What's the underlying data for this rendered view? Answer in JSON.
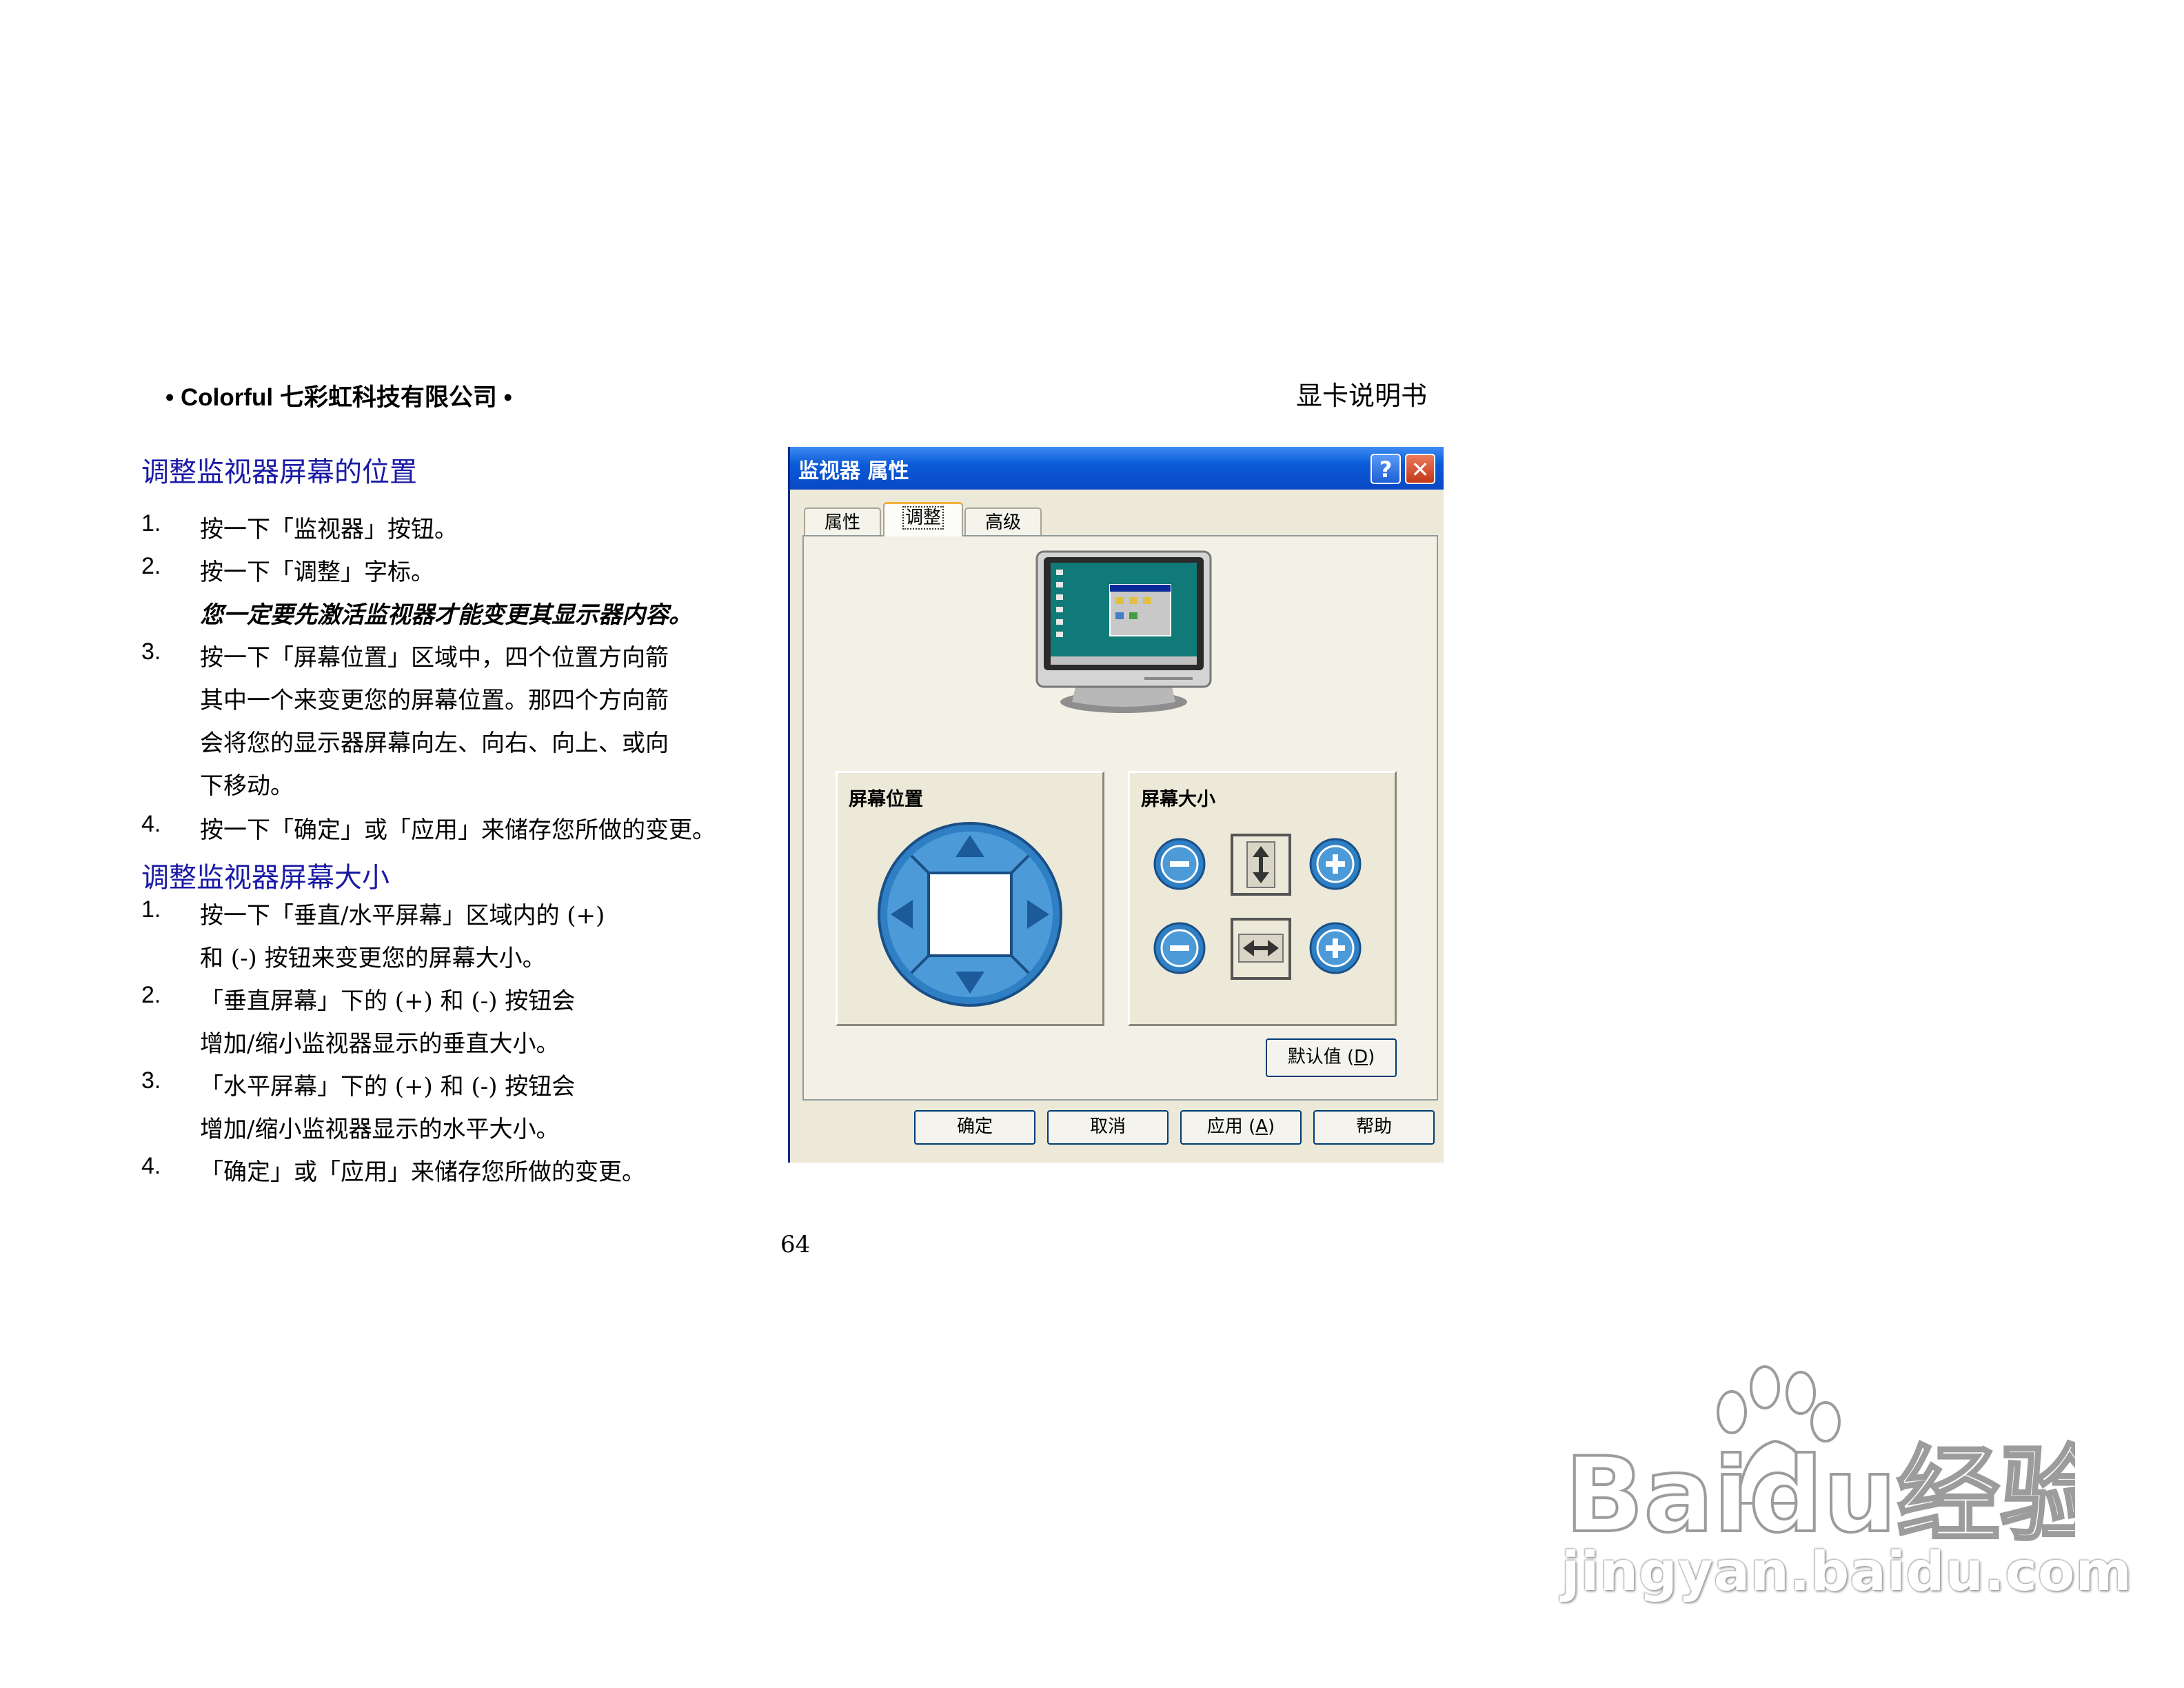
{
  "header": {
    "left": "• Colorful  七彩虹科技有限公司 •",
    "right": "显卡说明书"
  },
  "section1": {
    "heading": "调整监视器屏幕的位置",
    "items": [
      {
        "num": "1.",
        "lines": [
          "按一下「监视器」按钮。"
        ]
      },
      {
        "num": "2.",
        "lines": [
          "按一下「调整」字标。"
        ],
        "note": "您一定要先激活监视器才能变更其显示器内容。"
      },
      {
        "num": "3.",
        "lines": [
          "按一下「屏幕位置」区域中，四个位置方向箭",
          "其中一个来变更您的屏幕位置。那四个方向箭",
          "会将您的显示器屏幕向左、向右、向上、或向",
          "下移动。"
        ]
      },
      {
        "num": "4.",
        "lines": [
          "按一下「确定」或「应用」来储存您所做的变更。"
        ]
      }
    ]
  },
  "section2": {
    "heading": "调整监视器屏幕大小",
    "items": [
      {
        "num": "1.",
        "lines": [
          "按一下「垂直/水平屏幕」区域内的  (+)",
          "和  (-)  按钮来变更您的屏幕大小。"
        ]
      },
      {
        "num": "2.",
        "lines": [
          "「垂直屏幕」下的  (+)  和  (-)  按钮会",
          "增加/缩小监视器显示的垂直大小。"
        ]
      },
      {
        "num": "3.",
        "lines": [
          "「水平屏幕」下的  (+)  和  (-)  按钮会",
          "增加/缩小监视器显示的水平大小。"
        ]
      },
      {
        "num": "4.",
        "lines": [
          "「确定」或「应用」来储存您所做的变更。"
        ]
      }
    ]
  },
  "dialog": {
    "title": "监视器  属性",
    "help_glyph": "?",
    "close_glyph": "✕",
    "tabs": [
      "属性",
      "调整",
      "高级"
    ],
    "active_tab": "调整",
    "position_group": "屏幕位置",
    "size_group": "屏幕大小",
    "defaults_button": "默认值",
    "defaults_key": "D",
    "buttons": {
      "ok": "确定",
      "cancel": "取消",
      "apply": "应用",
      "apply_key": "A",
      "help": "帮助"
    }
  },
  "page_number": "64",
  "watermark": {
    "brand": "Baidu经验",
    "url": "jingyan.baidu.com"
  },
  "colors": {
    "heading": "#1a1aa6",
    "titlebar": "#0a5bd8",
    "arrow_pad": "#3a8fd0"
  }
}
